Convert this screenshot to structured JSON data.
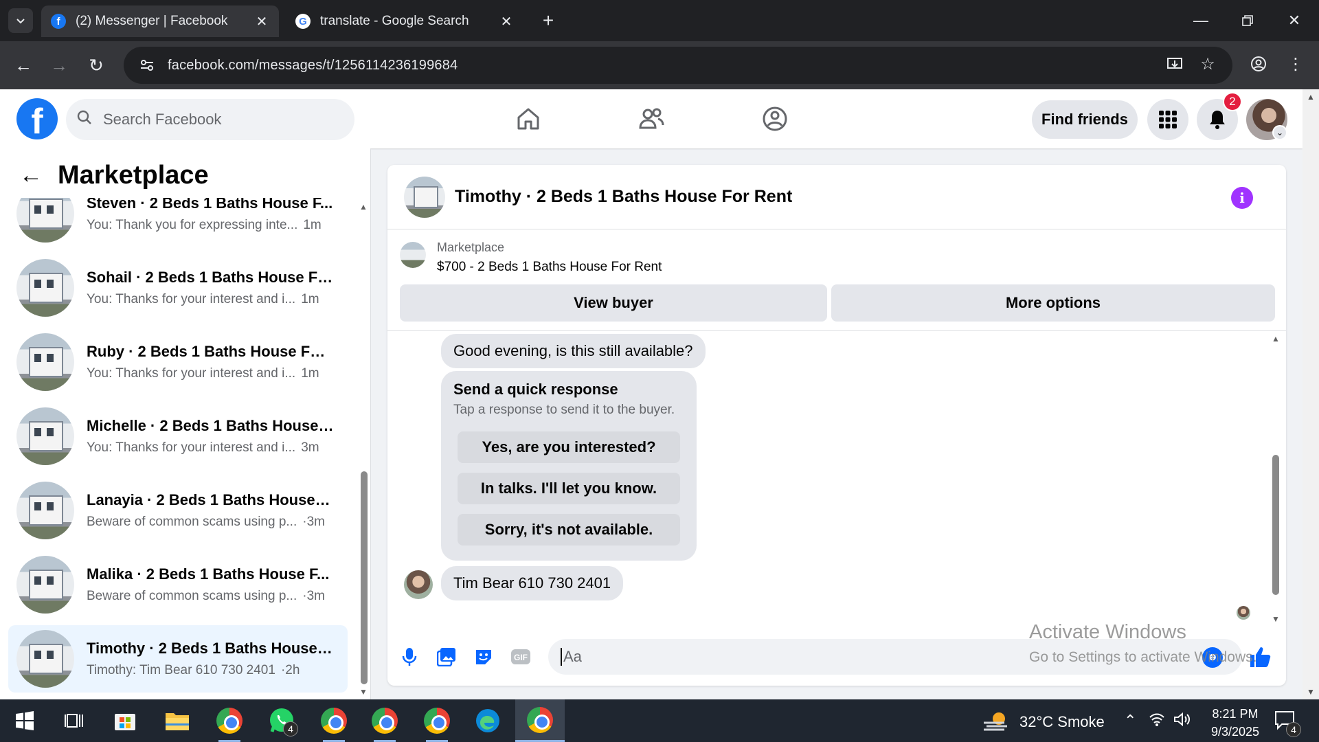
{
  "browser": {
    "tabs": [
      {
        "title": "(2) Messenger | Facebook",
        "favicon": "facebook-icon",
        "active": true
      },
      {
        "title": "translate - Google Search",
        "favicon": "google-icon",
        "active": false
      }
    ],
    "url": "facebook.com/messages/t/1256114236199684"
  },
  "facebook": {
    "search_placeholder": "Search Facebook",
    "find_friends_label": "Find friends",
    "notification_count": "2",
    "brand_color": "#1877f2"
  },
  "sidebar": {
    "title": "Marketplace",
    "conversations": [
      {
        "name": "Steven · 2 Beds 1 Baths House F...",
        "snippet": "You: Thank you for expressing inte...",
        "time": "1m"
      },
      {
        "name": "Sohail · 2 Beds 1 Baths House Fo...",
        "snippet": "You: Thanks for your interest and i...",
        "time": "1m"
      },
      {
        "name": "Ruby · 2 Beds 1 Baths House For...",
        "snippet": "You: Thanks for your interest and i...",
        "time": "1m"
      },
      {
        "name": "Michelle · 2 Beds 1 Baths House ...",
        "snippet": "You: Thanks for your interest and i...",
        "time": "3m"
      },
      {
        "name": "Lanayia · 2 Beds 1 Baths House F...",
        "snippet": "Beware of common scams using p...",
        "time": "·3m"
      },
      {
        "name": "Malika · 2 Beds 1 Baths House F...",
        "snippet": "Beware of common scams using p...",
        "time": "·3m"
      },
      {
        "name": "Timothy · 2 Beds 1 Baths House ...",
        "snippet": "Timothy: Tim Bear 610 730 2401",
        "time": "·2h",
        "selected": true
      }
    ]
  },
  "chat": {
    "title": "Timothy · 2 Beds 1 Baths House For Rent",
    "listing": {
      "category": "Marketplace",
      "name": "$700 - 2 Beds 1 Baths House For Rent",
      "view_buyer_label": "View buyer",
      "more_options_label": "More options"
    },
    "messages": {
      "first": "Good evening, is this still available?",
      "quick_response": {
        "title": "Send a quick response",
        "subtitle": "Tap a response to send it to the buyer.",
        "options": [
          "Yes, are you interested?",
          "In talks. I'll let you know.",
          "Sorry, it's not available."
        ]
      },
      "last": "Tim Bear 610 730 2401"
    },
    "composer_placeholder": "Aa",
    "accent_color": "#0866ff"
  },
  "watermark": {
    "line1": "Activate Windows",
    "line2": "Go to Settings to activate Windows."
  },
  "taskbar": {
    "whatsapp_badge": "4",
    "weather": "32°C  Smoke",
    "time": "8:21 PM",
    "date": "9/3/2025",
    "notification_badge": "4"
  }
}
